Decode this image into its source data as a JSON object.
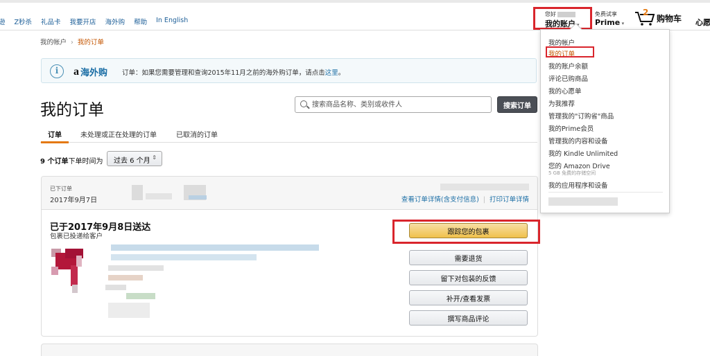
{
  "nav": {
    "links": [
      "逊",
      "Z秒杀",
      "礼品卡",
      "我要开店",
      "海外购",
      "帮助",
      "In English"
    ],
    "account_hello": "您好",
    "account_main": "我的账户",
    "prime_top": "免费试享",
    "prime_main": "Prime",
    "cart_count": "2",
    "cart_label": "购物车",
    "wishlist_label": "心愿单"
  },
  "breadcrumb": {
    "parent": "我的帐户",
    "separator": "›",
    "current": "我的订单"
  },
  "banner": {
    "brand_mark": "a",
    "brand_text": "海外购",
    "text": "订单：如果您需要管理和查询2015年11月之前的海外购订单，请点击",
    "link": "这里",
    "end": "。"
  },
  "page_title": "我的订单",
  "search": {
    "placeholder": "搜索商品名称、类别或收件人",
    "button": "搜索订单"
  },
  "tabs": {
    "orders": "订单",
    "open": "未处理或正在处理的订单",
    "cancelled": "已取消的订单"
  },
  "filter": {
    "count": "9 个订单",
    "text": "下单时间为",
    "selected": "过去 6 个月"
  },
  "order": {
    "placed_label": "已下订单",
    "placed_date": "2017年9月7日",
    "details_link": "查看订单详情(含支付信息)",
    "invoice_link": "打印订单详情",
    "delivered_title": "已于2017年9月8日送达",
    "delivered_sub": "包裹已投递给客户",
    "buttons": {
      "track": "跟踪您的包裹",
      "return": "需要退货",
      "feedback": "留下对包装的反馈",
      "invoice": "补开/查看发票",
      "review": "撰写商品评论"
    }
  },
  "dropdown": {
    "items": [
      "我的帐户",
      "我的订单",
      "我的账户余额",
      "评论已购商品",
      "我的心愿单",
      "为我推荐",
      "管理我的\"订购省\"商品",
      "我的Prime会员",
      "管理我的内容和设备",
      "我的 Kindle Unlimited",
      "您的 Amazon Drive",
      "我的应用程序和设备"
    ],
    "drive_note": "5 GB 免费的存储空间"
  },
  "colors": {
    "link": "#1b6ea5",
    "accent_orange": "#e47911",
    "highlight_red": "#d9252c",
    "primary_button": "#f0c14b"
  }
}
